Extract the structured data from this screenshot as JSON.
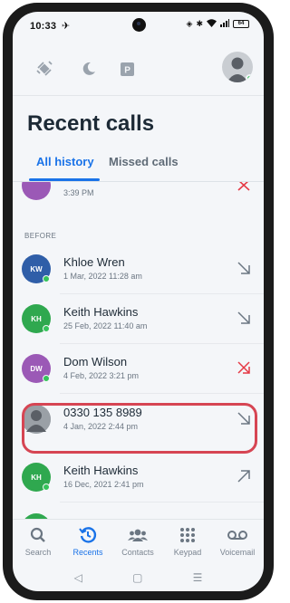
{
  "status_bar": {
    "time": "10:33",
    "battery": "64"
  },
  "header": {
    "title": "Recent calls"
  },
  "tabs": [
    {
      "label": "All history",
      "active": true
    },
    {
      "label": "Missed calls",
      "active": false
    }
  ],
  "calls_top_partial": {
    "time": "3:39 PM",
    "avatar_color": "#9b59b6",
    "direction": "missed"
  },
  "section_label": "BEFORE",
  "calls": [
    {
      "initials": "KW",
      "name": "Khloe Wren",
      "datetime": "1 Mar, 2022 11:28 am",
      "avatar_color": "#2f5ea8",
      "presence": "#35c35a",
      "direction": "incoming",
      "icon": "arrow-down-right-icon"
    },
    {
      "initials": "KH",
      "name": "Keith Hawkins",
      "datetime": "25 Feb, 2022 11:40 am",
      "avatar_color": "#2fa84f",
      "presence": "#35c35a",
      "direction": "incoming",
      "icon": "arrow-down-right-icon"
    },
    {
      "initials": "DW",
      "name": "Dom Wilson",
      "datetime": "4 Feb, 2022 3:21 pm",
      "avatar_color": "#9b59b6",
      "presence": "#35c35a",
      "direction": "missed",
      "icon": "missed-call-icon"
    },
    {
      "initials": "",
      "name": "0330 135 8989",
      "datetime": "4 Jan, 2022 2:44 pm",
      "avatar_color": "#9aa0a6",
      "presence": "",
      "direction": "incoming",
      "icon": "arrow-down-right-icon",
      "highlighted": true
    },
    {
      "initials": "KH",
      "name": "Keith Hawkins",
      "datetime": "16 Dec, 2021 2:41 pm",
      "avatar_color": "#2fa84f",
      "presence": "#35c35a",
      "direction": "outgoing",
      "icon": "arrow-up-right-icon"
    }
  ],
  "bottom_nav": [
    {
      "label": "Search",
      "icon": "search-icon",
      "active": false
    },
    {
      "label": "Recents",
      "icon": "recents-icon",
      "active": true
    },
    {
      "label": "Contacts",
      "icon": "contacts-icon",
      "active": false
    },
    {
      "label": "Keypad",
      "icon": "keypad-icon",
      "active": false
    },
    {
      "label": "Voicemail",
      "icon": "voicemail-icon",
      "active": false
    }
  ],
  "colors": {
    "accent": "#1a73e8",
    "missed": "#e53945",
    "highlight": "#d64553"
  }
}
